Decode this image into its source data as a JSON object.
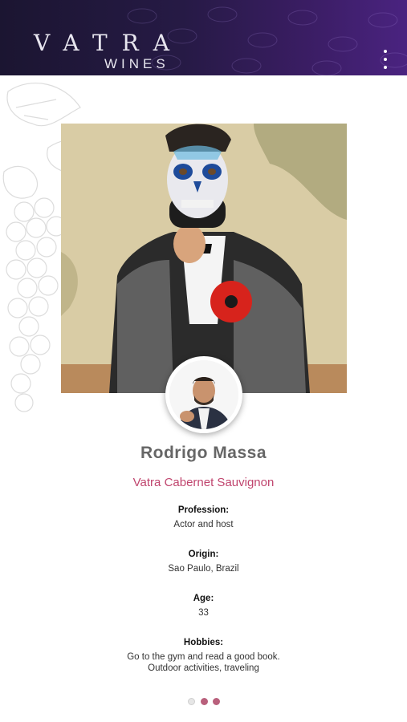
{
  "header": {
    "logo_main": "VATRA",
    "logo_sub": "WINES",
    "menu_icon": "more-vertical-icon",
    "background_color": "#1b1531",
    "accent_color": "#4a2380"
  },
  "profile": {
    "name": "Rodrigo Massa",
    "wine": "Vatra Cabernet Sauvignon",
    "wine_color": "#c0456e",
    "fields": [
      {
        "label": "Profession:",
        "value": "Actor and host"
      },
      {
        "label": "Origin:",
        "value": "Sao Paulo, Brazil"
      },
      {
        "label": "Age:",
        "value": "33"
      },
      {
        "label": "Hobbies:",
        "value_line1": "Go to the gym and read a good book.",
        "value_line2": "Outdoor activities, traveling"
      }
    ]
  },
  "pagination": {
    "total": 3,
    "active_dots": [
      2,
      3
    ],
    "active_color": "#b9607c"
  }
}
